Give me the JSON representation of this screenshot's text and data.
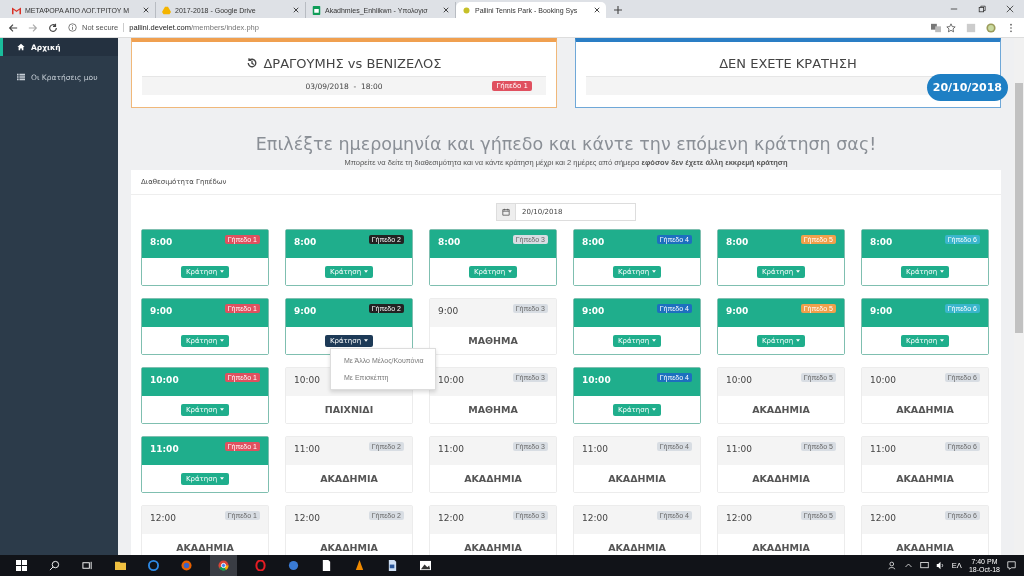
{
  "browser": {
    "tabs": [
      {
        "title": "ΜΕΤΑΦΟΡΑ ΑΠΟ ΛΟΓ.ΤΡΙΤΟΥ Μ",
        "selected": false
      },
      {
        "title": "2017-2018 - Google Drive",
        "selected": false
      },
      {
        "title": "Akadhmies_Enhlikwn - Υπολογισ",
        "selected": false
      },
      {
        "title": "Pallini Tennis Park - Booking Sys",
        "selected": true
      }
    ],
    "security": "Not secure",
    "url_host": "pallini.develet.com",
    "url_path": "/members/index.php"
  },
  "sidebar": {
    "items": [
      {
        "label": "Αρχική",
        "selected": true
      },
      {
        "label": "Οι Κρατήσεις μου",
        "selected": false
      }
    ]
  },
  "cards": [
    {
      "kind": "last",
      "title": "ΔΡΑΓΟΥΜΗΣ vs ΒΕΝΙΖΕΛΟΣ",
      "date": "03/09/2018  -  18:00",
      "court": "Γήπεδο 1"
    },
    {
      "kind": "next",
      "title": "ΔΕΝ ΕΧΕΤΕ ΚΡΑΤΗΣΗ",
      "badge": "20/10/2018"
    }
  ],
  "heading": "Επιλέξτε ημερομηνία και γήπεδο και κάντε την επόμενη κράτηση σας!",
  "subtitle": "Μπορείτε να δείτε τη διαθεσιμότητα και να κάντε κράτηση μέχρι και 2 ημέρες από σήμερα **εφόσον δεν έχετε άλλη εκκρεμή κράτηση**",
  "panel": {
    "title": "Διαθεσιμότητα Γηπέδων",
    "date": "20/10/2018",
    "rows": [
      {
        "slots": [
          {
            "time": "8:00",
            "court": "Γήπεδο 1",
            "color": "#e0505f",
            "kind": "free",
            "button": "Κράτηση",
            "open": false
          },
          {
            "time": "8:00",
            "court": "Γήπεδο 2",
            "color": "#222222",
            "kind": "free",
            "button": "Κράτηση",
            "open": false
          },
          {
            "time": "8:00",
            "court": "Γήπεδο 3",
            "color": "#d8dde3",
            "kind": "free",
            "button": "Κράτηση",
            "open": false
          },
          {
            "time": "8:00",
            "court": "Γήπεδο 4",
            "color": "#1d6fbf",
            "kind": "free",
            "button": "Κράτηση",
            "open": false
          },
          {
            "time": "8:00",
            "court": "Γήπεδο 5",
            "color": "#f0a04b",
            "kind": "free",
            "button": "Κράτηση",
            "open": false
          },
          {
            "time": "8:00",
            "court": "Γήπεδο 6",
            "color": "#3ab6cc",
            "kind": "free",
            "button": "Κράτηση",
            "open": false
          }
        ]
      },
      {
        "slots": [
          {
            "time": "9:00",
            "court": "Γήπεδο 1",
            "color": "#e0505f",
            "kind": "free",
            "button": "Κράτηση",
            "open": false
          },
          {
            "time": "9:00",
            "court": "Γήπεδο 2",
            "color": "#222222",
            "kind": "free",
            "button": "Κράτηση",
            "open": true,
            "menu": [
              "Με Άλλο Μέλος/Κουπόνια",
              "Με Επισκέπτη"
            ]
          },
          {
            "time": "9:00",
            "court": "Γήπεδο 3",
            "color": "#d8dde3",
            "kind": "booked",
            "status": "ΜΑΘΗΜΑ"
          },
          {
            "time": "9:00",
            "court": "Γήπεδο 4",
            "color": "#1d6fbf",
            "kind": "free",
            "button": "Κράτηση",
            "open": false
          },
          {
            "time": "9:00",
            "court": "Γήπεδο 5",
            "color": "#f0a04b",
            "kind": "free",
            "button": "Κράτηση",
            "open": false
          },
          {
            "time": "9:00",
            "court": "Γήπεδο 6",
            "color": "#3ab6cc",
            "kind": "free",
            "button": "Κράτηση",
            "open": false
          }
        ]
      },
      {
        "slots": [
          {
            "time": "10:00",
            "court": "Γήπεδο 1",
            "color": "#e0505f",
            "kind": "free",
            "button": "Κράτηση",
            "open": false
          },
          {
            "time": "10:00",
            "kind": "booked",
            "status": "ΠΑΙΧΝΙΔΙ"
          },
          {
            "time": "10:00",
            "court": "Γήπεδο 3",
            "color": "#d8dde3",
            "kind": "booked",
            "status": "ΜΑΘΗΜΑ"
          },
          {
            "time": "10:00",
            "court": "Γήπεδο 4",
            "color": "#1d6fbf",
            "kind": "free",
            "button": "Κράτηση",
            "open": false
          },
          {
            "time": "10:00",
            "court": "Γήπεδο 5",
            "color": "#d8dde3",
            "kind": "booked",
            "status": "ΑΚΑΔΗΜΙΑ"
          },
          {
            "time": "10:00",
            "court": "Γήπεδο 6",
            "color": "#d8dde3",
            "kind": "booked",
            "status": "ΑΚΑΔΗΜΙΑ"
          }
        ]
      },
      {
        "slots": [
          {
            "time": "11:00",
            "court": "Γήπεδο 1",
            "color": "#e0505f",
            "kind": "free",
            "button": "Κράτηση",
            "open": false
          },
          {
            "time": "11:00",
            "court": "Γήπεδο 2",
            "color": "#d8dde3",
            "kind": "booked",
            "status": "ΑΚΑΔΗΜΙΑ"
          },
          {
            "time": "11:00",
            "court": "Γήπεδο 3",
            "color": "#d8dde3",
            "kind": "booked",
            "status": "ΑΚΑΔΗΜΙΑ"
          },
          {
            "time": "11:00",
            "court": "Γήπεδο 4",
            "color": "#d8dde3",
            "kind": "booked",
            "status": "ΑΚΑΔΗΜΙΑ"
          },
          {
            "time": "11:00",
            "court": "Γήπεδο 5",
            "color": "#d8dde3",
            "kind": "booked",
            "status": "ΑΚΑΔΗΜΙΑ"
          },
          {
            "time": "11:00",
            "court": "Γήπεδο 6",
            "color": "#d8dde3",
            "kind": "booked",
            "status": "ΑΚΑΔΗΜΙΑ"
          }
        ]
      },
      {
        "slots": [
          {
            "time": "12:00",
            "court": "Γήπεδο 1",
            "color": "#d8dde3",
            "kind": "booked",
            "status": "ΑΚΑΔΗΜΙΑ"
          },
          {
            "time": "12:00",
            "court": "Γήπεδο 2",
            "color": "#d8dde3",
            "kind": "booked",
            "status": "ΑΚΑΔΗΜΙΑ"
          },
          {
            "time": "12:00",
            "court": "Γήπεδο 3",
            "color": "#d8dde3",
            "kind": "booked",
            "status": "ΑΚΑΔΗΜΙΑ"
          },
          {
            "time": "12:00",
            "court": "Γήπεδο 4",
            "color": "#d8dde3",
            "kind": "booked",
            "status": "ΑΚΑΔΗΜΙΑ"
          },
          {
            "time": "12:00",
            "court": "Γήπεδο 5",
            "color": "#d8dde3",
            "kind": "booked",
            "status": "ΑΚΑΔΗΜΙΑ"
          },
          {
            "time": "12:00",
            "court": "Γήπεδο 6",
            "color": "#d8dde3",
            "kind": "booked",
            "status": "ΑΚΑΔΗΜΙΑ"
          }
        ]
      }
    ]
  },
  "taskbar": {
    "language": "ΕΛ",
    "time": "7:40 PM",
    "date": "18-Oct-18"
  }
}
